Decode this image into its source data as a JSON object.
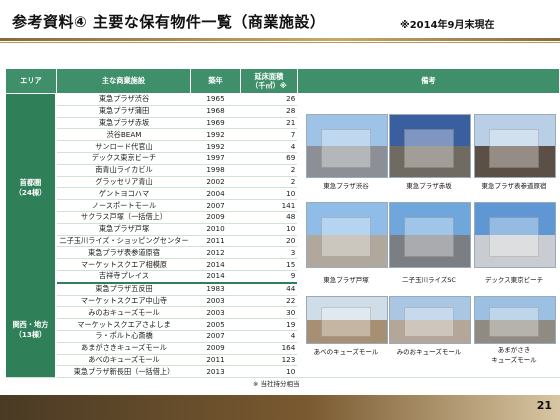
{
  "header": {
    "title": "参考資料④ 主要な保有物件一覧（商業施設）",
    "note": "※2014年9月末現在"
  },
  "table": {
    "columns": {
      "area": "エリア",
      "name": "主な商業施設",
      "year": "築年",
      "floor": "延床面積\n（千㎡）※",
      "remarks": "備考"
    },
    "groups": [
      {
        "area": "首都圏\n（24棟）",
        "rows": [
          {
            "name": "東急プラザ渋谷",
            "year": "1965",
            "floor": "26"
          },
          {
            "name": "東急プラザ蒲田",
            "year": "1968",
            "floor": "28"
          },
          {
            "name": "東急プラザ赤坂",
            "year": "1969",
            "floor": "21"
          },
          {
            "name": "渋谷BEAM",
            "year": "1992",
            "floor": "7"
          },
          {
            "name": "サンロード代官山",
            "year": "1992",
            "floor": "4"
          },
          {
            "name": "デックス東京ビーチ",
            "year": "1997",
            "floor": "69"
          },
          {
            "name": "南青山ライカビル",
            "year": "1998",
            "floor": "2"
          },
          {
            "name": "グラッセリア青山",
            "year": "2002",
            "floor": "2"
          },
          {
            "name": "ゲントヨコハマ",
            "year": "2004",
            "floor": "10"
          },
          {
            "name": "ノースポートモール",
            "year": "2007",
            "floor": "141"
          },
          {
            "name": "サクラス戸塚（一括借上）",
            "year": "2009",
            "floor": "48"
          },
          {
            "name": "東急プラザ戸塚",
            "year": "2010",
            "floor": "10"
          },
          {
            "name": "二子玉川ライズ・ショッピングセンター",
            "year": "2011",
            "floor": "20"
          },
          {
            "name": "東急プラザ表参道原宿",
            "year": "2012",
            "floor": "3"
          },
          {
            "name": "マーケットスクエア相模原",
            "year": "2014",
            "floor": "15"
          },
          {
            "name": "吉祥寺プレイス",
            "year": "2014",
            "floor": "9"
          }
        ]
      },
      {
        "area": "関西・地方\n（13棟）",
        "rows": [
          {
            "name": "東急プラザ五反田",
            "year": "1983",
            "floor": "44"
          },
          {
            "name": "マーケットスクエア中山寺",
            "year": "2003",
            "floor": "22"
          },
          {
            "name": "みのおキューズモール",
            "year": "2003",
            "floor": "30"
          },
          {
            "name": "マーケットスクエアさよしま",
            "year": "2005",
            "floor": "19"
          },
          {
            "name": "ラ・ポルト心斎橋",
            "year": "2007",
            "floor": "4"
          },
          {
            "name": "あまがさきキューズモール",
            "year": "2009",
            "floor": "164"
          },
          {
            "name": "あべのキューズモール",
            "year": "2011",
            "floor": "123"
          },
          {
            "name": "東急プラザ新長田（一括借上）",
            "year": "2013",
            "floor": "10"
          }
        ]
      }
    ]
  },
  "photos": [
    {
      "caption": "東急プラザ渋谷",
      "sky": "#9fc3e6",
      "ground": "#8d8f96"
    },
    {
      "caption": "東急プラザ赤坂",
      "sky": "#3a5f9e",
      "ground": "#6f6a62"
    },
    {
      "caption": "東急プラザ表参道原宿",
      "sky": "#b8cfe6",
      "ground": "#5c4f45"
    },
    {
      "caption": "東急プラザ戸塚",
      "sky": "#8fbde8",
      "ground": "#b0a89c"
    },
    {
      "caption": "二子玉川ライズSC",
      "sky": "#6fa6dc",
      "ground": "#7b7e83"
    },
    {
      "caption": "デックス東京ビーチ",
      "sky": "#5f97d4",
      "ground": "#c9ccd0"
    },
    {
      "caption": "あべのキューズモール",
      "sky": "#cfdde8",
      "ground": "#a68f72"
    },
    {
      "caption": "みのおキューズモール",
      "sky": "#a9c7e3",
      "ground": "#b4a79a"
    },
    {
      "caption": "あまがさき\nキューズモール",
      "sky": "#9cc0e2",
      "ground": "#8f8a82"
    }
  ],
  "footnote": "※ 当社持分相当",
  "page_number": "21"
}
